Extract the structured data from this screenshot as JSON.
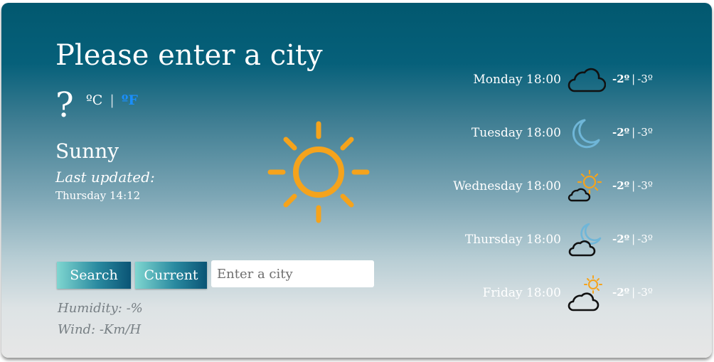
{
  "header": {
    "title": "Please enter a city"
  },
  "current": {
    "temperature": "?",
    "unit_celsius": "ºC",
    "unit_separator": "|",
    "unit_fahrenheit": "ºF",
    "condition": "Sunny",
    "last_updated_label": "Last updated:",
    "last_updated_time": "Thursday 14:12",
    "icon": "sun-icon",
    "humidity": "Humidity: -%",
    "wind": "Wind: -Km/H"
  },
  "controls": {
    "search_label": "Search",
    "current_label": "Current",
    "city_placeholder": "Enter a city",
    "city_value": ""
  },
  "forecast": [
    {
      "day": "Monday 18:00",
      "icon": "cloud-icon",
      "max": "-2º",
      "sep": "|",
      "min": "-3º"
    },
    {
      "day": "Tuesday 18:00",
      "icon": "moon-icon",
      "max": "-2º",
      "sep": "|",
      "min": "-3º"
    },
    {
      "day": "Wednesday 18:00",
      "icon": "sun-cloud-icon",
      "max": "-2º",
      "sep": "|",
      "min": "-3º"
    },
    {
      "day": "Thursday 18:00",
      "icon": "moon-cloud-icon",
      "max": "-2º",
      "sep": "|",
      "min": "-3º"
    },
    {
      "day": "Friday 18:00",
      "icon": "sun-cloud-icon",
      "max": "-2º",
      "sep": "|",
      "min": "-3º"
    }
  ],
  "colors": {
    "sun": "#f5a31c",
    "moon": "#6fb6d8",
    "cloud_stroke": "#111111",
    "fahrenheit_link": "#1a8fff"
  }
}
